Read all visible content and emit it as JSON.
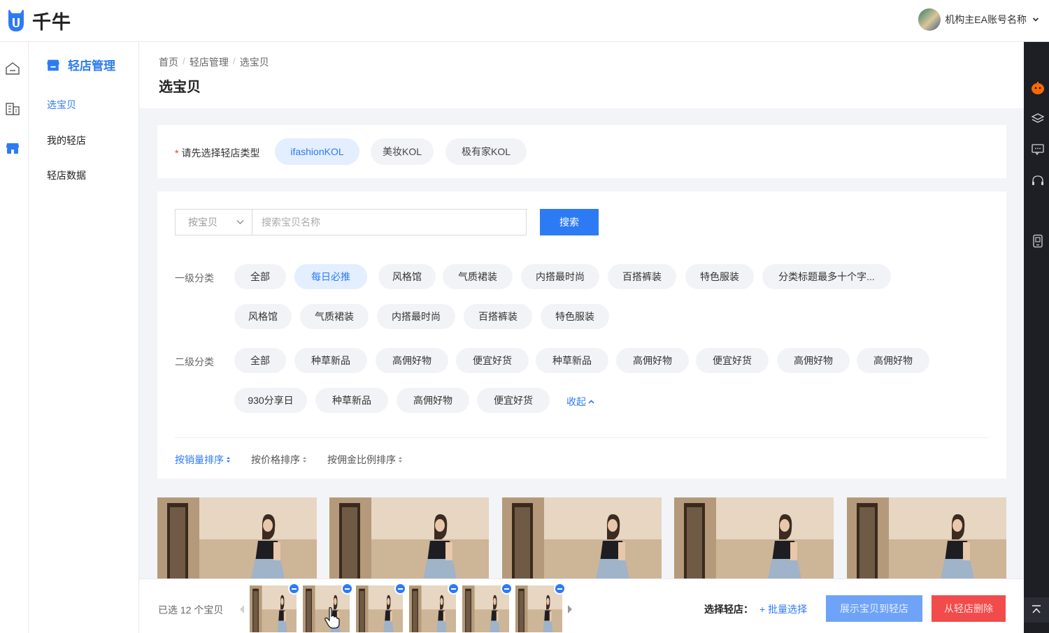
{
  "brand": {
    "logo_text": "千牛"
  },
  "account": {
    "name": "机构主EA账号名称"
  },
  "subnav": {
    "title": "轻店管理",
    "items": [
      {
        "label": "选宝贝",
        "active": true
      },
      {
        "label": "我的轻店",
        "active": false
      },
      {
        "label": "轻店数据",
        "active": false
      }
    ]
  },
  "breadcrumb": [
    "首页",
    "轻店管理",
    "选宝贝"
  ],
  "page_title": "选宝贝",
  "shop_type": {
    "label": "请先选择轻店类型",
    "options": [
      {
        "label": "ifashionKOL",
        "active": true
      },
      {
        "label": "美妆KOL",
        "active": false
      },
      {
        "label": "极有家KOL",
        "active": false
      }
    ]
  },
  "search": {
    "mode": "按宝贝",
    "placeholder": "搜索宝贝名称",
    "button": "搜索"
  },
  "level1": {
    "label": "一级分类",
    "tags": [
      {
        "label": "全部",
        "active": false
      },
      {
        "label": "每日必推",
        "active": true
      },
      {
        "label": "风格馆",
        "active": false
      },
      {
        "label": "气质裙装",
        "active": false
      },
      {
        "label": "内搭最时尚",
        "active": false
      },
      {
        "label": "百搭裤装",
        "active": false
      },
      {
        "label": "特色服装",
        "active": false
      },
      {
        "label": "分类标题最多十个字...",
        "active": false
      },
      {
        "label": "风格馆",
        "active": false
      },
      {
        "label": "气质裙装",
        "active": false
      },
      {
        "label": "内搭最时尚",
        "active": false
      },
      {
        "label": "百搭裤装",
        "active": false
      },
      {
        "label": "特色服装",
        "active": false
      }
    ]
  },
  "level2": {
    "label": "二级分类",
    "tags": [
      {
        "label": "全部"
      },
      {
        "label": "种草新品"
      },
      {
        "label": "高佣好物"
      },
      {
        "label": "便宜好货"
      },
      {
        "label": "种草新品"
      },
      {
        "label": "高佣好物"
      },
      {
        "label": "便宜好货"
      },
      {
        "label": "高佣好物"
      },
      {
        "label": "高佣好物"
      },
      {
        "label": "930分享日"
      },
      {
        "label": "种草新品"
      },
      {
        "label": "高佣好物"
      },
      {
        "label": "便宜好货"
      }
    ],
    "collapse": "收起"
  },
  "sort": [
    {
      "label": "按销量排序",
      "active": true
    },
    {
      "label": "按价格排序",
      "active": false
    },
    {
      "label": "按佣金比例排序",
      "active": false
    }
  ],
  "selection": {
    "count_text": "已选 12 个宝贝",
    "shop_label": "选择轻店：",
    "batch_select": "+ 批量选择",
    "show_button": "展示宝贝到轻店",
    "delete_button": "从轻店删除"
  },
  "colors": {
    "primary": "#2d7bf4",
    "danger": "#f24b4b",
    "rail_dark": "#1d1f24"
  }
}
